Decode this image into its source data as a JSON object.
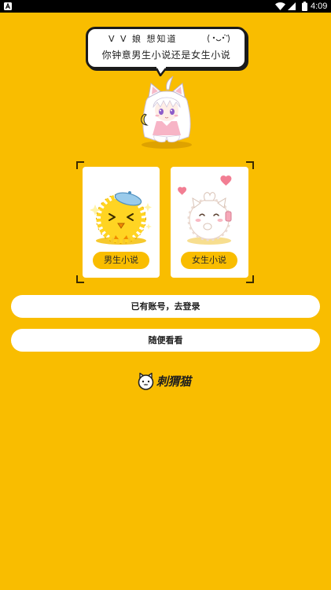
{
  "status_bar": {
    "time": "4:09",
    "left_icon": "app-notification-icon",
    "right_icons": [
      "wifi-icon",
      "signal-icon",
      "battery-icon"
    ]
  },
  "bubble": {
    "line1": "V V 娘 想知道",
    "line2": "你钟意男生小说还是女生小说",
    "decoration_icon": "kaomoji-face-icon"
  },
  "mascot": {
    "icon": "cat-ear-girl-mascot"
  },
  "choices": [
    {
      "label": "男生小说",
      "art_icon": "fluffy-yellow-chick-art"
    },
    {
      "label": "女生小说",
      "art_icon": "white-cat-hearts-art"
    }
  ],
  "actions": {
    "login_label": "已有账号，去登录",
    "browse_label": "随便看看"
  },
  "logo": {
    "text": "刺猬猫",
    "icon": "cat-face-logo-icon"
  },
  "colors": {
    "background": "#F9BD00",
    "card": "#FFFFFF",
    "button_accent": "#F9BD00",
    "text": "#1E1E1E"
  }
}
